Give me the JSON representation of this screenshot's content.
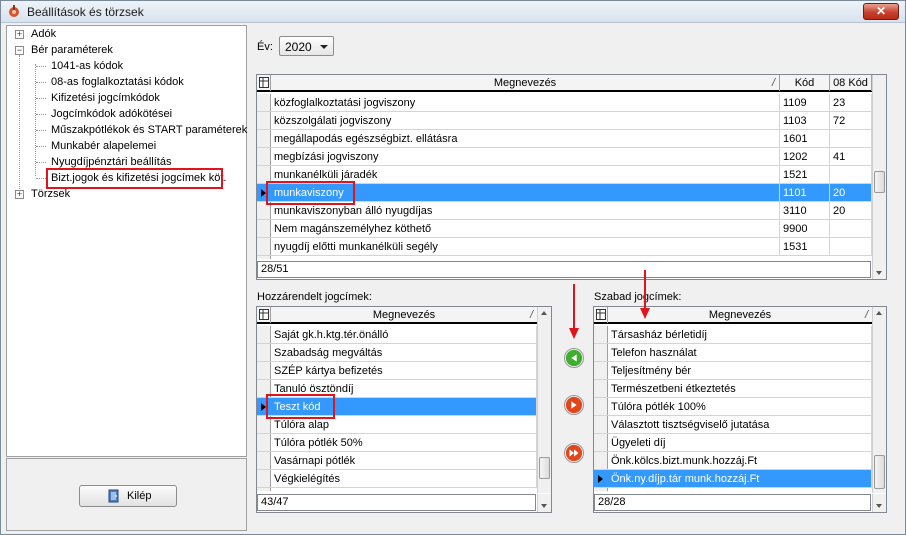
{
  "window": {
    "title": "Beállítások és törzsek",
    "close_label": "✕"
  },
  "tree": {
    "adok": "Adók",
    "ber": "Bér paraméterek",
    "children": [
      "1041-as kódok",
      "08-as foglalkoztatási kódok",
      "Kifizetési jogcímkódok",
      "Jogcímkódok adókötései",
      "Műszakpótlékok és START paraméterek",
      "Munkabér alapelemei",
      "Nyugdíjpénztári beállítás",
      "Bizt.jogok és kifizetési jogcímek köt."
    ],
    "torzsek": "Törzsek"
  },
  "exit_button": "Kilép",
  "year": {
    "label": "Év:",
    "value": "2020"
  },
  "top_grid": {
    "headers": [
      "Megnevezés",
      "Kód",
      "08 Kód"
    ],
    "sort_mark": "/",
    "rows": [
      [
        "közfoglalkoztatási jogviszony",
        "1109",
        "23"
      ],
      [
        "közszolgálati jogviszony",
        "1103",
        "72"
      ],
      [
        "megállapodás egészségbizt. ellátásra",
        "1601",
        ""
      ],
      [
        "megbízási jogviszony",
        "1202",
        "41"
      ],
      [
        "munkanélküli járadék",
        "1521",
        ""
      ],
      [
        "munkaviszony",
        "1101",
        "20"
      ],
      [
        "munkaviszonyban álló nyugdíjas",
        "3110",
        "20"
      ],
      [
        "Nem magánszemélyhez köthető",
        "9900",
        ""
      ],
      [
        "nyugdíj előtti munkanélküli segély",
        "1531",
        ""
      ]
    ],
    "selected_index": 5,
    "footer": "28/51"
  },
  "assigned": {
    "label": "Hozzárendelt jogcímek:",
    "header": "Megnevezés",
    "rows": [
      "Saját gk.h.ktg.tér.önálló",
      "Szabadság megváltás",
      "SZÉP kártya befizetés",
      "Tanuló ösztöndíj",
      "Teszt kód",
      "Túlóra alap",
      "Túlóra pótlék 50%",
      "Vasárnapi pótlék",
      "Végkielégítés"
    ],
    "selected_index": 4,
    "footer": "43/47"
  },
  "free": {
    "label": "Szabad jogcímek:",
    "header": "Megnevezés",
    "rows": [
      "Társasház bérletidíj",
      "Telefon használat",
      "Teljesítmény bér",
      "Természetbeni étkeztetés",
      "Túlóra pótlék 100%",
      "Választott tisztségviselő jutatása",
      "Ügyeleti díj",
      "Önk.kölcs.bizt.munk.hozzáj.Ft",
      "Önk.ny.díjp.tár munk.hozzáj.Ft"
    ],
    "selected_index": 8,
    "footer": "28/28"
  },
  "colors": {
    "selection": "#3399ff",
    "annotation": "#e0141c",
    "move_left": "#3fae2f",
    "move_right": "#e2471c"
  },
  "icons": [
    "app-icon",
    "close-icon",
    "door-exit-icon",
    "arrow-left-icon",
    "arrow-right-icon",
    "double-arrow-right-icon",
    "grid-settings-icon"
  ]
}
